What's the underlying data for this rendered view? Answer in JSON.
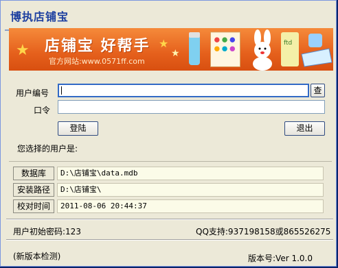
{
  "window": {
    "title": "博执店铺宝"
  },
  "banner": {
    "slogan": "店铺宝 好帮手",
    "site": "官方网站:www.0571ff.com"
  },
  "login": {
    "user_label": "用户编号",
    "user_value": "",
    "lookup_label": "查",
    "password_label": "口令",
    "password_value": "",
    "login_label": "登陆",
    "exit_label": "退出",
    "selected_user_label": "您选择的用户是:"
  },
  "info": [
    {
      "label": "数据库",
      "value": "D:\\店铺宝\\data.mdb"
    },
    {
      "label": "安装路径",
      "value": "D:\\店铺宝\\"
    },
    {
      "label": "校对时间",
      "value": "2011-08-06 20:44:37"
    }
  ],
  "footer": {
    "initial_password": "用户初始密码:123",
    "qq_support": "QQ支持:937198158或865526275",
    "check_update": "(新版本检测)",
    "version": "版本号:Ver 1.0.0"
  },
  "colors": {
    "banner": "#e5601c",
    "title": "#1c3fa0",
    "panel": "#ece9d8"
  }
}
